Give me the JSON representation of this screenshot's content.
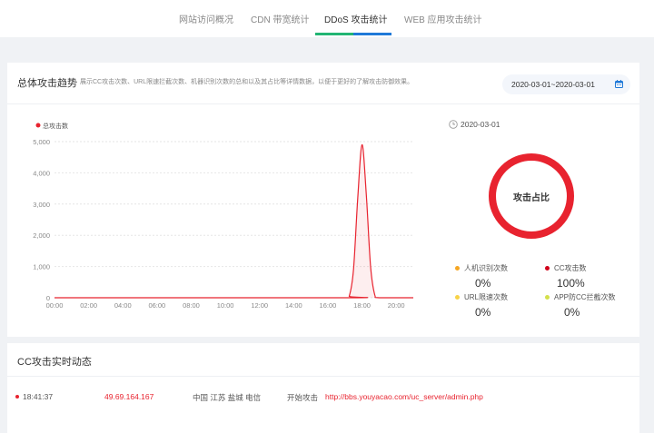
{
  "tabs": [
    {
      "label": "网站访问概况",
      "active": false
    },
    {
      "label": "CDN 带宽统计",
      "active": false
    },
    {
      "label": "DDoS 攻击统计",
      "active": true
    },
    {
      "label": "WEB 应用攻击统计",
      "active": false
    }
  ],
  "colors": {
    "accent_blue": "#1f79d8",
    "accent_green": "#22b573",
    "attack_red": "#e8232f",
    "background": "#f0f2f5"
  },
  "trend": {
    "title": "总体攻击趋势",
    "description": "展示CC攻击次数、URL限速拦截次数、机器识别次数的总和以及其占比等详情数据，以便于更好的了解攻击防御效果。",
    "date_range": "2020-03-01~2020-03-01",
    "calendar_icon": "calendar-icon"
  },
  "chart_data": {
    "type": "line",
    "series": [
      {
        "name": "总攻击数",
        "color": "#e8232f"
      }
    ],
    "x_ticks": [
      "00:00",
      "02:00",
      "04:00",
      "06:00",
      "08:00",
      "10:00",
      "12:00",
      "14:00",
      "16:00",
      "18:00",
      "20:00"
    ],
    "y_ticks": [
      "0",
      "1,000",
      "2,000",
      "3,000",
      "4,000",
      "5,000"
    ],
    "ylim": [
      0,
      5000
    ],
    "xlim_hours": [
      0,
      21
    ],
    "points": [
      [
        0,
        0
      ],
      [
        17.0,
        0
      ],
      [
        17.25,
        50
      ],
      [
        17.5,
        900
      ],
      [
        17.75,
        3200
      ],
      [
        18.0,
        4900
      ],
      [
        18.25,
        3300
      ],
      [
        18.5,
        1000
      ],
      [
        18.75,
        80
      ],
      [
        19.0,
        0
      ],
      [
        21,
        0
      ]
    ],
    "grid": true
  },
  "ratio": {
    "date": "2020-03-01",
    "clock_icon": "clock-icon",
    "center_label": "攻击占比",
    "stats": [
      {
        "label": "人机识别次数",
        "value": "0%",
        "color": "#f5a623"
      },
      {
        "label": "CC攻击数",
        "value": "100%",
        "color": "#d0021b"
      },
      {
        "label": "URL限速次数",
        "value": "0%",
        "color": "#f8d347"
      },
      {
        "label": "APP防CC拦截次数",
        "value": "0%",
        "color": "#d4e04a"
      }
    ]
  },
  "cc_log": {
    "title": "CC攻击实时动态",
    "entries": [
      {
        "time": "18:41:37",
        "ip": "49.69.164.167",
        "location": "中国 江苏 盐城 电信",
        "action": "开始攻击",
        "url": "http://bbs.youyacao.com/uc_server/admin.php"
      }
    ]
  }
}
